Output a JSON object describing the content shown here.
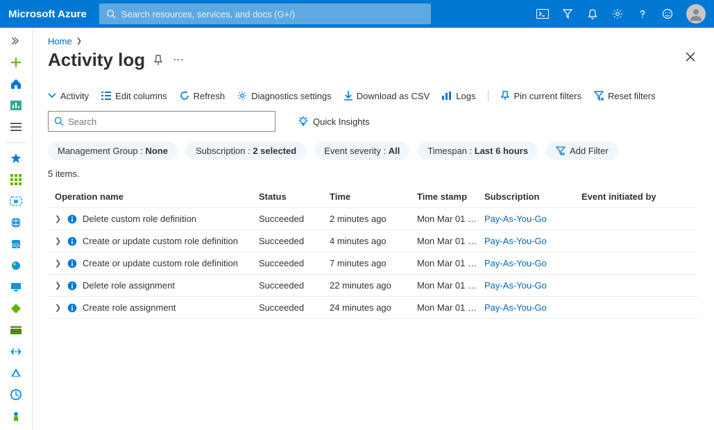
{
  "brand": "Microsoft Azure",
  "search_placeholder": "Search resources, services, and docs (G+/)",
  "breadcrumb": {
    "home": "Home"
  },
  "page_title": "Activity log",
  "toolbar": {
    "activity": "Activity",
    "edit_columns": "Edit columns",
    "refresh": "Refresh",
    "diag": "Diagnostics settings",
    "csv": "Download as CSV",
    "logs": "Logs",
    "pin": "Pin current filters",
    "reset": "Reset filters"
  },
  "grid_search_placeholder": "Search",
  "quick_insights": "Quick Insights",
  "pills": {
    "mg_label": "Management Group : ",
    "mg_value": "None",
    "sub_label": "Subscription : ",
    "sub_value": "2 selected",
    "sev_label": "Event severity : ",
    "sev_value": "All",
    "time_label": "Timespan : ",
    "time_value": "Last 6 hours",
    "add": "Add Filter"
  },
  "items_count": "5 items.",
  "columns": {
    "op": "Operation name",
    "status": "Status",
    "time": "Time",
    "ts": "Time stamp",
    "sub": "Subscription",
    "init": "Event initiated by"
  },
  "rows": [
    {
      "op": "Delete custom role definition",
      "status": "Succeeded",
      "time": "2 minutes ago",
      "ts": "Mon Mar 01 …",
      "sub": "Pay-As-You-Go"
    },
    {
      "op": "Create or update custom role definition",
      "status": "Succeeded",
      "time": "4 minutes ago",
      "ts": "Mon Mar 01 …",
      "sub": "Pay-As-You-Go"
    },
    {
      "op": "Create or update custom role definition",
      "status": "Succeeded",
      "time": "7 minutes ago",
      "ts": "Mon Mar 01 …",
      "sub": "Pay-As-You-Go"
    },
    {
      "op": "Delete role assignment",
      "status": "Succeeded",
      "time": "22 minutes ago",
      "ts": "Mon Mar 01 …",
      "sub": "Pay-As-You-Go"
    },
    {
      "op": "Create role assignment",
      "status": "Succeeded",
      "time": "24 minutes ago",
      "ts": "Mon Mar 01 …",
      "sub": "Pay-As-You-Go"
    }
  ]
}
